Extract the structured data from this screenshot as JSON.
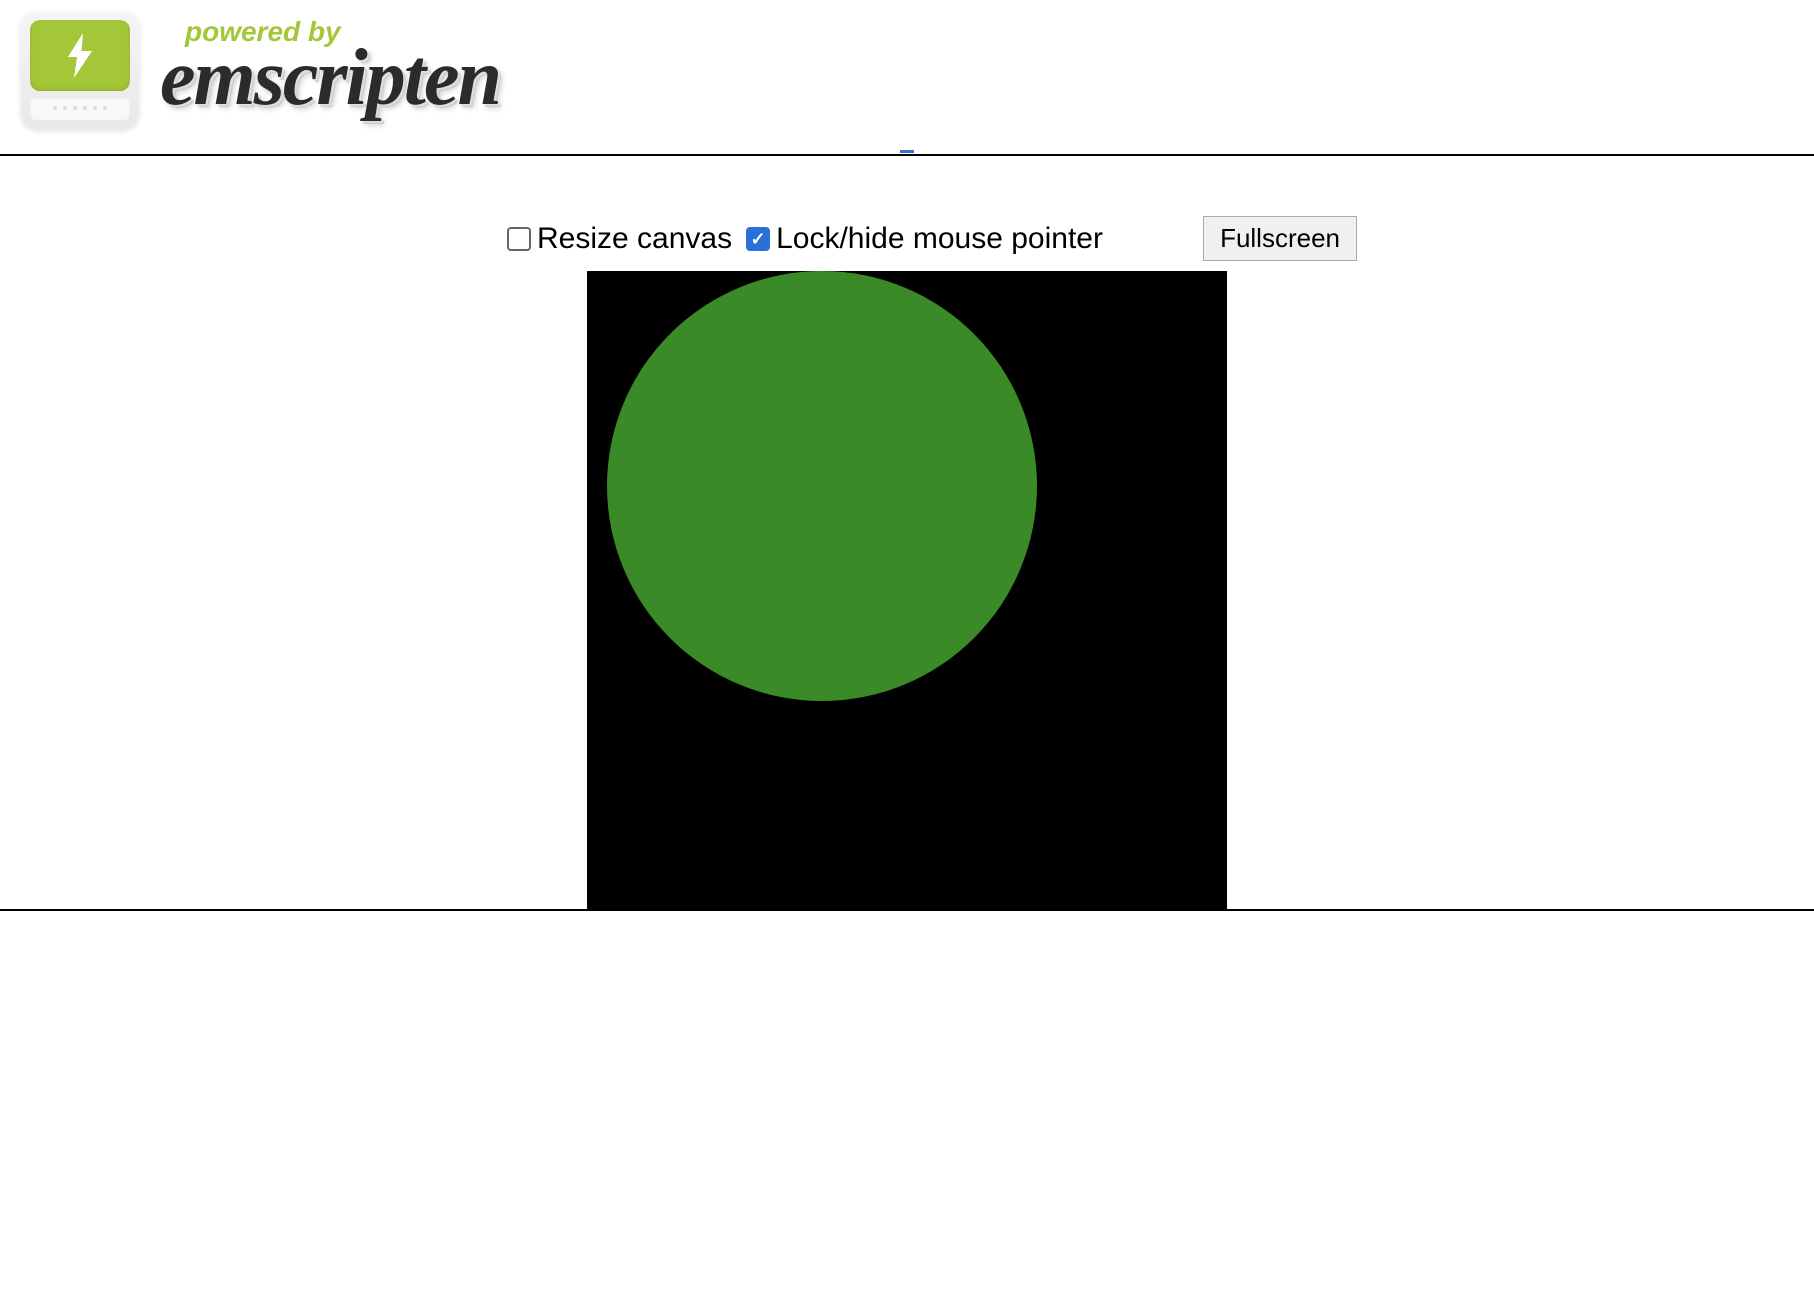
{
  "header": {
    "powered_by": "powered by",
    "brand": "emscripten"
  },
  "controls": {
    "resize_label": "Resize canvas",
    "resize_checked": false,
    "lock_label": "Lock/hide mouse pointer",
    "lock_checked": true,
    "fullscreen_label": "Fullscreen"
  },
  "canvas": {
    "background": "#000000",
    "circle_color": "#3a8a28"
  }
}
